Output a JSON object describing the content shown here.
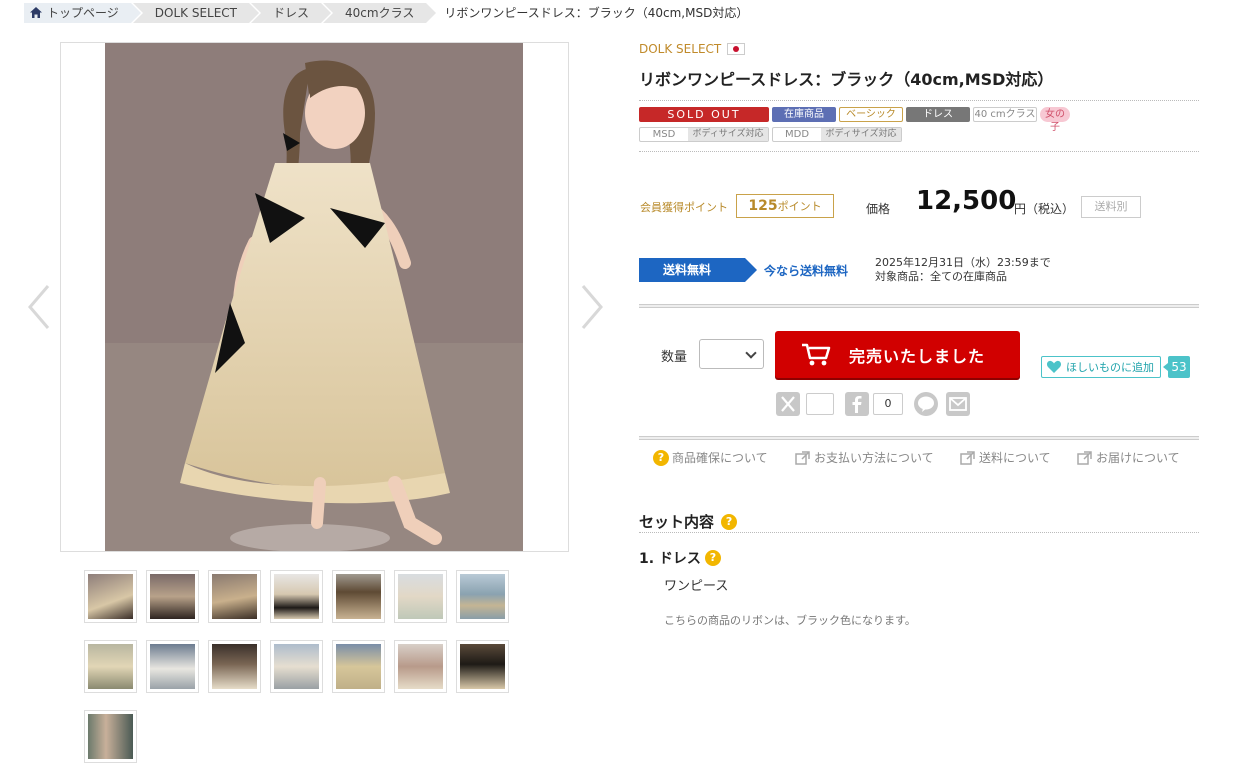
{
  "breadcrumb": [
    {
      "label": "トップページ"
    },
    {
      "label": "DOLK SELECT"
    },
    {
      "label": "ドレス"
    },
    {
      "label": "40cmクラス"
    },
    {
      "label": "リボンワンピースドレス：ブラック（40cm,MSD対応）"
    }
  ],
  "product": {
    "brand": "DOLK SELECT",
    "title": "リボンワンピースドレス：ブラック（40cm,MSD対応）",
    "tags": {
      "soldout": "SOLD OUT",
      "stock": "在庫商品",
      "basic": "ベーシック",
      "dress": "ドレス",
      "size": "40 cmクラス",
      "girl": "女の子",
      "body1": "MSD",
      "body1_note": "ボディサイズ対応",
      "body2": "MDD",
      "body2_note": "ボディサイズ対応"
    }
  },
  "points": {
    "label": "会員獲得ポイント",
    "value": "125",
    "unit": "ポイント"
  },
  "price": {
    "label": "価格",
    "value": "12,500",
    "unit": "円（税込）",
    "shipping": "送料別"
  },
  "free_shipping": {
    "badge": "送料無料",
    "now": "今なら送料無料",
    "until": "2025年12月31日（水）23:59まで",
    "target": "対象商品：全ての在庫商品"
  },
  "purchase": {
    "qty_label": "数量",
    "qty_value": "",
    "soldout_button": "完売いたしました",
    "wishlist_button": "ほしいものに追加",
    "wishlist_count": "53"
  },
  "share": {
    "x_count": "",
    "fb_count": "0"
  },
  "info_links": [
    {
      "label": "商品確保について"
    },
    {
      "label": "お支払い方法について"
    },
    {
      "label": "送料について"
    },
    {
      "label": "お届けについて"
    }
  ],
  "set": {
    "title": "セット内容",
    "item_title": "1. ドレス",
    "item_desc": "ワンピース",
    "note": "こちらの商品のリボンは、ブラック色になります。"
  },
  "colors": {
    "soldout_red": "#d10000",
    "shipping_blue": "#1d66c2",
    "wish_teal": "#4cc3c9",
    "brand_gold": "#c08a2a"
  }
}
